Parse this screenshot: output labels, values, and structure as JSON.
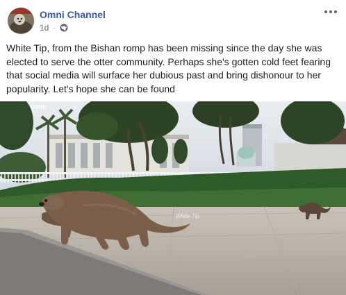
{
  "post": {
    "page_name": "Omni Channel",
    "timestamp": "1d",
    "separator": "·",
    "privacy_icon": "globe-icon",
    "more_icon": "more-horizontal-icon",
    "text": "White Tip, from the Bishan romp has been missing since the day she was elected to serve the otter community. Perhaps she's gotten cold feet fearing that social media will surface her dubious past and bring dishonour to her popularity. Let's hope she can be found"
  },
  "photo": {
    "watermark_brand": "OMNI",
    "watermark_caption": "White Tip"
  },
  "colors": {
    "page_name": "#365899",
    "meta_text": "#606770",
    "body_text": "#1c1e21"
  }
}
